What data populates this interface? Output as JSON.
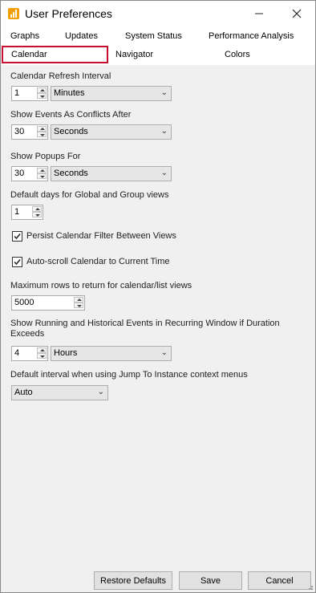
{
  "window": {
    "title": "User Preferences"
  },
  "tabs": [
    {
      "label": "Graphs"
    },
    {
      "label": "Updates"
    },
    {
      "label": "System Status"
    },
    {
      "label": "Performance Analysis"
    },
    {
      "label": "Calendar"
    },
    {
      "label": "Navigator"
    },
    {
      "label": "Colors"
    }
  ],
  "settings": {
    "refresh": {
      "label": "Calendar Refresh Interval",
      "value": "1",
      "unit": "Minutes"
    },
    "conflicts": {
      "label": "Show Events As Conflicts After",
      "value": "30",
      "unit": "Seconds"
    },
    "popups": {
      "label": "Show Popups For",
      "value": "30",
      "unit": "Seconds"
    },
    "default_days": {
      "label": "Default days for Global and Group views",
      "value": "1"
    },
    "persist_filter": {
      "label": "Persist Calendar Filter Between Views",
      "checked": true
    },
    "autoscroll": {
      "label": "Auto-scroll Calendar to Current Time",
      "checked": true
    },
    "max_rows": {
      "label": "Maximum rows to return for calendar/list views",
      "value": "5000"
    },
    "running_events": {
      "label_line1": "Show Running and Historical Events in Recurring Window if Duration",
      "label_line2": "Exceeds",
      "value": "4",
      "unit": "Hours"
    },
    "jump_interval": {
      "label": "Default interval when using Jump To Instance context menus",
      "value": "Auto"
    }
  },
  "footer": {
    "restore_label": "Restore Defaults",
    "save_label": "Save",
    "cancel_label": "Cancel"
  },
  "colors": {
    "accent": "#c8102e",
    "icon": "#f0a000"
  }
}
